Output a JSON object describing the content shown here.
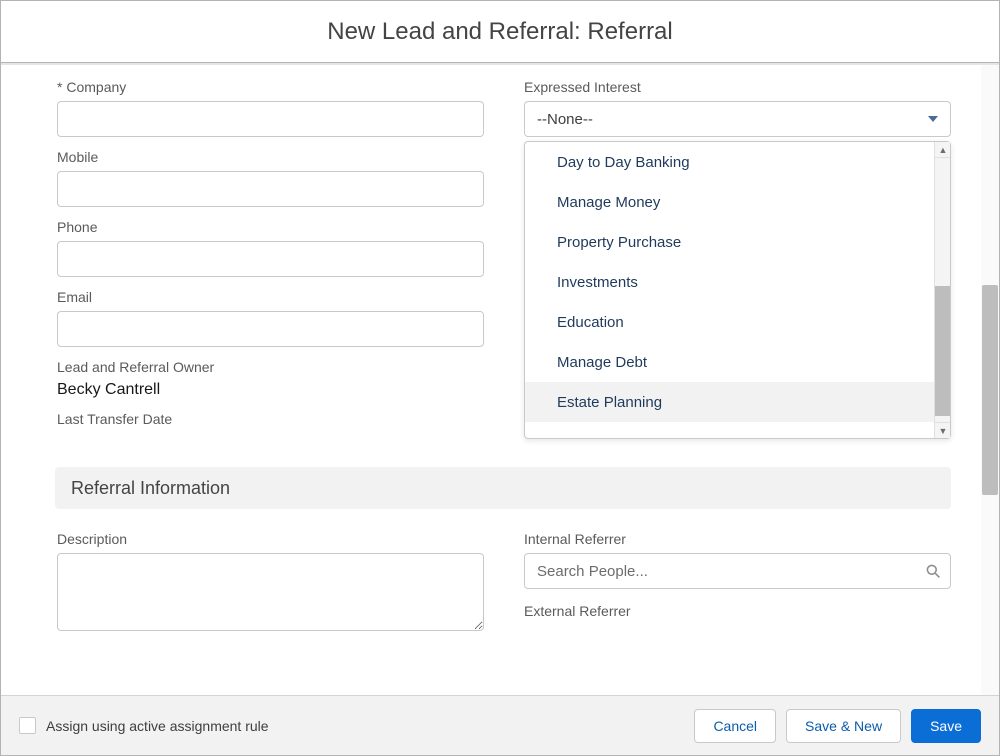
{
  "header": {
    "title": "New Lead and Referral: Referral"
  },
  "left": {
    "company_label": "Company",
    "mobile_label": "Mobile",
    "phone_label": "Phone",
    "email_label": "Email",
    "owner_label": "Lead and Referral Owner",
    "owner_value": "Becky Cantrell",
    "transfer_label": "Last Transfer Date"
  },
  "right": {
    "interest_label": "Expressed Interest",
    "interest_selected": "--None--",
    "interest_options": [
      "Day to Day Banking",
      "Manage Money",
      "Property Purchase",
      "Investments",
      "Education",
      "Manage Debt",
      "Estate Planning"
    ]
  },
  "section": {
    "referral_info": "Referral Information"
  },
  "referral": {
    "description_label": "Description",
    "internal_label": "Internal Referrer",
    "internal_placeholder": "Search People...",
    "external_label": "External Referrer"
  },
  "footer": {
    "assign_label": "Assign using active assignment rule",
    "cancel": "Cancel",
    "save_new": "Save & New",
    "save": "Save"
  }
}
